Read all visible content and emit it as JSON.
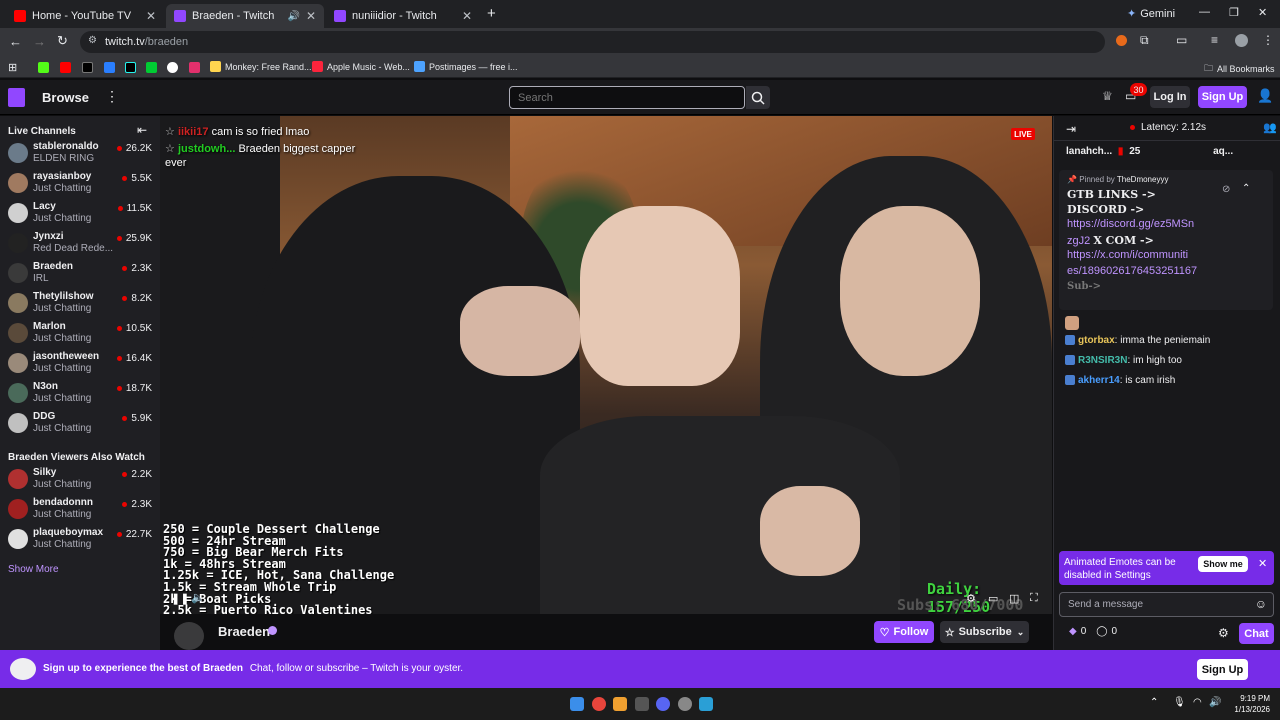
{
  "browser": {
    "tabs": [
      {
        "title": "Home - YouTube TV",
        "favicon_color": "#ff0000"
      },
      {
        "title": "Braeden - Twitch",
        "favicon_color": "#9147ff"
      },
      {
        "title": "nuniiidior - Twitch",
        "favicon_color": "#9147ff"
      }
    ],
    "gemini_label": "Gemini",
    "url_host": "twitch.tv",
    "url_path": "/braeden",
    "bookmarks": [
      {
        "label": "Monkey: Free Rand...",
        "color": "#ffd54f"
      },
      {
        "label": "Apple Music - Web...",
        "color": "#fa243c"
      },
      {
        "label": "Postimages — free i...",
        "color": "#4da3ff"
      }
    ],
    "all_bookmarks": "All Bookmarks"
  },
  "topnav": {
    "browse": "Browse",
    "search_placeholder": "Search",
    "notification_count": "30",
    "login": "Log In",
    "signup": "Sign Up"
  },
  "sidebar": {
    "live_channels_title": "Live Channels",
    "live_channels": [
      {
        "name": "stableronaldo",
        "game": "ELDEN RING",
        "viewers": "26.2K",
        "color": "#6b7b8a"
      },
      {
        "name": "rayasianboy",
        "game": "Just Chatting",
        "viewers": "5.5K",
        "color": "#a07a60"
      },
      {
        "name": "Lacy",
        "game": "Just Chatting",
        "viewers": "11.5K",
        "color": "#d0d0d0"
      },
      {
        "name": "Jynxzi",
        "game": "Red Dead Rede...",
        "viewers": "25.9K",
        "color": "#222222"
      },
      {
        "name": "Braeden",
        "game": "IRL",
        "viewers": "2.3K",
        "color": "#3a3a3a"
      },
      {
        "name": "Thetylilshow",
        "game": "Just Chatting",
        "viewers": "8.2K",
        "color": "#8a7a60"
      },
      {
        "name": "Marlon",
        "game": "Just Chatting",
        "viewers": "10.5K",
        "color": "#5a4a3a"
      },
      {
        "name": "jasontheween",
        "game": "Just Chatting",
        "viewers": "16.4K",
        "color": "#9a8a7a"
      },
      {
        "name": "N3on",
        "game": "Just Chatting",
        "viewers": "18.7K",
        "color": "#4a6a5a"
      },
      {
        "name": "DDG",
        "game": "Just Chatting",
        "viewers": "5.9K",
        "color": "#c0c0c0"
      }
    ],
    "also_watch_title": "Braeden Viewers Also Watch",
    "also_watch": [
      {
        "name": "Silky",
        "game": "Just Chatting",
        "viewers": "2.2K",
        "color": "#b03030"
      },
      {
        "name": "bendadonnn",
        "game": "Just Chatting",
        "viewers": "2.3K",
        "color": "#a02020"
      },
      {
        "name": "plaqueboymax",
        "game": "Just Chatting",
        "viewers": "22.7K",
        "color": "#e0e0e0"
      }
    ],
    "show_more": "Show More"
  },
  "player": {
    "live_label": "LIVE",
    "overlay_chat": [
      {
        "user": "iikii17",
        "text": "cam is so fried lmao",
        "user_color": "#cc2222"
      },
      {
        "user": "justdowh...",
        "text": "Braeden biggest capper",
        "user_color": "#22cc22"
      },
      {
        "user": "",
        "text": "ever",
        "user_color": "#ffffff"
      }
    ],
    "goals": [
      "250 = Couple Dessert Challenge",
      "500 = 24hr Stream",
      "750 = Big Bear Merch Fits",
      "1k = 48hrs Stream",
      "1.25k = ICE, Hot, Sana Challenge",
      "1.5k = Stream Whole Trip",
      "2k = Boat Picks",
      "2.5k = Puerto Rico Valentines"
    ],
    "daily": "Daily: 157/250",
    "subs": "Subs: 680/7000"
  },
  "channel": {
    "name": "Braeden",
    "follow": "Follow",
    "subscribe": "Subscribe"
  },
  "chat": {
    "latency": "Latency: 2.12s",
    "leader": {
      "name": "lanahch...",
      "count": "25",
      "other": "aq..."
    },
    "pinned_by_label": "Pinned by",
    "pinned_by_user": "TheDmoneyyy",
    "pinned_lines": [
      "GTB LINKS",
      "->",
      "DISCORD ->"
    ],
    "pinned_link1": "https://discord.gg/ez5MSn",
    "pinned_link1b": "zgJ2",
    "pinned_xcom": "X COM ->",
    "pinned_link2": "https://x.com/i/communiti",
    "pinned_link2b": "es/1896026176453251167",
    "pinned_sub": "Sub->",
    "messages": [
      {
        "user": "gtorbax",
        "text": "imma the peniemain",
        "color": "#e8c55a"
      },
      {
        "user": "R3NSIR3N",
        "text": "im high too",
        "color": "#44bbaa"
      },
      {
        "user": "akherr14",
        "text": "is cam irish",
        "color": "#4a9eff"
      }
    ],
    "tip_text": "Animated Emotes can be disabled in Settings",
    "tip_button": "Show me",
    "message_placeholder": "Send a message",
    "points1": "0",
    "points2": "0",
    "chat_button": "Chat"
  },
  "banner": {
    "bold": "Sign up to experience the best of Braeden",
    "text": "Chat, follow or subscribe – Twitch is your oyster.",
    "button": "Sign Up"
  },
  "taskbar": {
    "time": "9:19 PM",
    "date": "1/13/2026"
  }
}
